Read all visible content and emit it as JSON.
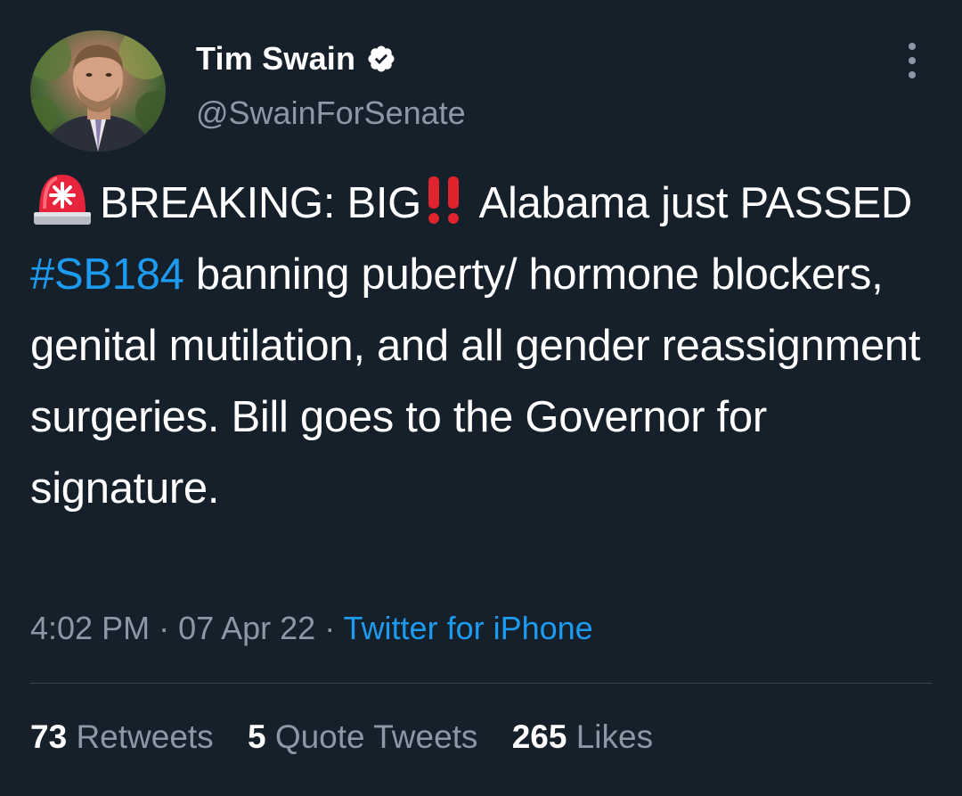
{
  "author": {
    "display_name": "Tim Swain",
    "handle": "@SwainForSenate",
    "verified_icon": "verified-badge-icon",
    "avatar_icon": "profile-photo"
  },
  "tweet": {
    "segments": {
      "s1": "BREAKING: BIG",
      "s2": " Alabama just PASSED ",
      "hashtag": "#SB184",
      "s3": " banning puberty/ hormone blockers, genital mutilation, and all gender reassignment surgeries. Bill goes to the Governor for signature."
    },
    "emojis": [
      "rotating-light-icon",
      "double-exclamation-icon"
    ]
  },
  "meta": {
    "time": "4:02 PM",
    "separator": " · ",
    "date": "07 Apr 22",
    "source": "Twitter for iPhone"
  },
  "stats": {
    "retweets_count": "73",
    "retweets_label": "Retweets",
    "quotes_count": "5",
    "quotes_label": "Quote Tweets",
    "likes_count": "265",
    "likes_label": "Likes"
  },
  "colors": {
    "background": "#15202b",
    "text": "#ffffff",
    "secondary": "#8b98a5",
    "accent": "#1d9bf0",
    "divider": "#38444d"
  }
}
